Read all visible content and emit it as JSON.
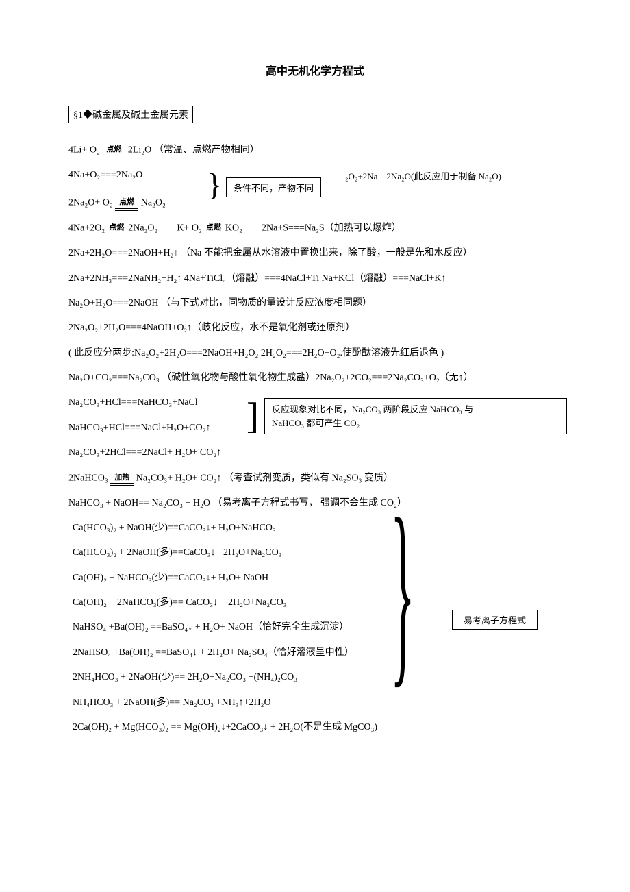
{
  "title": "高中无机化学方程式",
  "section1": {
    "heading": "§1◆碱金属及碱土金属元素",
    "cond_ignite": "点燃",
    "cond_heat": "加热",
    "eq1": "4Li+ O₂",
    "eq1_after": "2Li₂O  （常温、点燃产物相同）",
    "eq2": "4Na+O₂===2Na₂O",
    "eq3_pre": "2Na₂O+ O₂",
    "eq3_after": "Na₂O₂",
    "box1": "条件不同，产物不同",
    "eq2_right": "₂O₂+2Na＝2Na₂O(此反应用于制备 Na₂O)",
    "eq4_pre": "4Na+2O₂",
    "eq4_after": "2Na₂O₂",
    "eq4b_pre": "K+ O₂",
    "eq4b_after": "KO₂",
    "eq4c": "2Na+S===Na₂S（加热可以爆炸）",
    "eq5": "2Na+2H₂O===2NaOH+H₂↑   （Na 不能把金属从水溶液中置换出来，除了酸，一般是先和水反应）",
    "eq6": "2Na+2NH₃===2NaNH₂+H₂↑   4Na+TiCl₄（熔融）===4NaCl+Ti    Na+KCl（熔融）===NaCl+K↑",
    "eq7": "Na₂O+H₂O===2NaOH （与下式对比，同物质的量设计反应浓度相同题）",
    "eq8": "2Na₂O₂+2H₂O===4NaOH+O₂↑（歧化反应，水不是氧化剂或还原剂）",
    "eq9": "(  此反应分两步:Na₂O₂+2H₂O===2NaOH+H₂O₂   2H₂O₂===2H₂O+O₂.使酚酞溶液先红后退色 )",
    "eq10": "Na₂O+CO₂===Na₂CO₃  （碱性氧化物与酸性氧化物生成盐）2Na₂O₂+2CO₂===2Na₂CO₃+O₂（无↑）",
    "eq11": "Na₂CO₃+HCl===NaHCO₃+NaCl",
    "eq12": "NaHCO₃+HCl===NaCl+H₂O+CO₂↑",
    "note2a": "反应现象对比不同，Na₂CO₃ 两阶段反应 NaHCO₃ 与",
    "note2b": "NaHCO₃ 都可产生 CO₂",
    "eq13": "Na₂CO₃+2HCl===2NaCl+ H₂O+ CO₂↑",
    "eq14_pre": "2NaHCO₃",
    "eq14_after": " Na₂CO₃+ H₂O+ CO₂↑ （考查试剂变质，类似有 Na₂SO₃ 变质）",
    "eq15": "NaHCO₃ + NaOH== Na₂CO₃ + H₂O （易考离子方程式书写， 强调不会生成 CO₂）",
    "g1": "Ca(HCO₃)₂ + NaOH(少)==CaCO₃↓+ H₂O+NaHCO₃",
    "g2": "Ca(HCO₃)₂ + 2NaOH(多)==CaCO₃↓+ 2H₂O+Na₂CO₃",
    "g3": "Ca(OH)₂ + NaHCO₃(少)==CaCO₃↓+ H₂O+ NaOH",
    "g4": "Ca(OH)₂ + 2NaHCO₃(多)== CaCO₃↓  + 2H₂O+Na₂CO₃",
    "g5": "NaHSO₄ +Ba(OH)₂ ==BaSO₄↓  + H₂O+ NaOH（恰好完全生成沉淀）",
    "g6": "2NaHSO₄ +Ba(OH)₂ ==BaSO₄↓  + 2H₂O+ Na₂SO₄（恰好溶液呈中性）",
    "g7": "2NH₄HCO₃ + 2NaOH(少)==  2H₂O+Na₂CO₃ +(NH₄)₂CO₃",
    "g8": "NH₄HCO₃ + 2NaOH(多)==  Na₂CO₃ +NH₃↑+2H₂O",
    "g9": "2Ca(OH)₂ + Mg(HCO₃)₂ == Mg(OH)₂↓+2CaCO₃↓  + 2H₂O(不是生成 MgCO₃)",
    "ion_label": "易考离子方程式"
  }
}
